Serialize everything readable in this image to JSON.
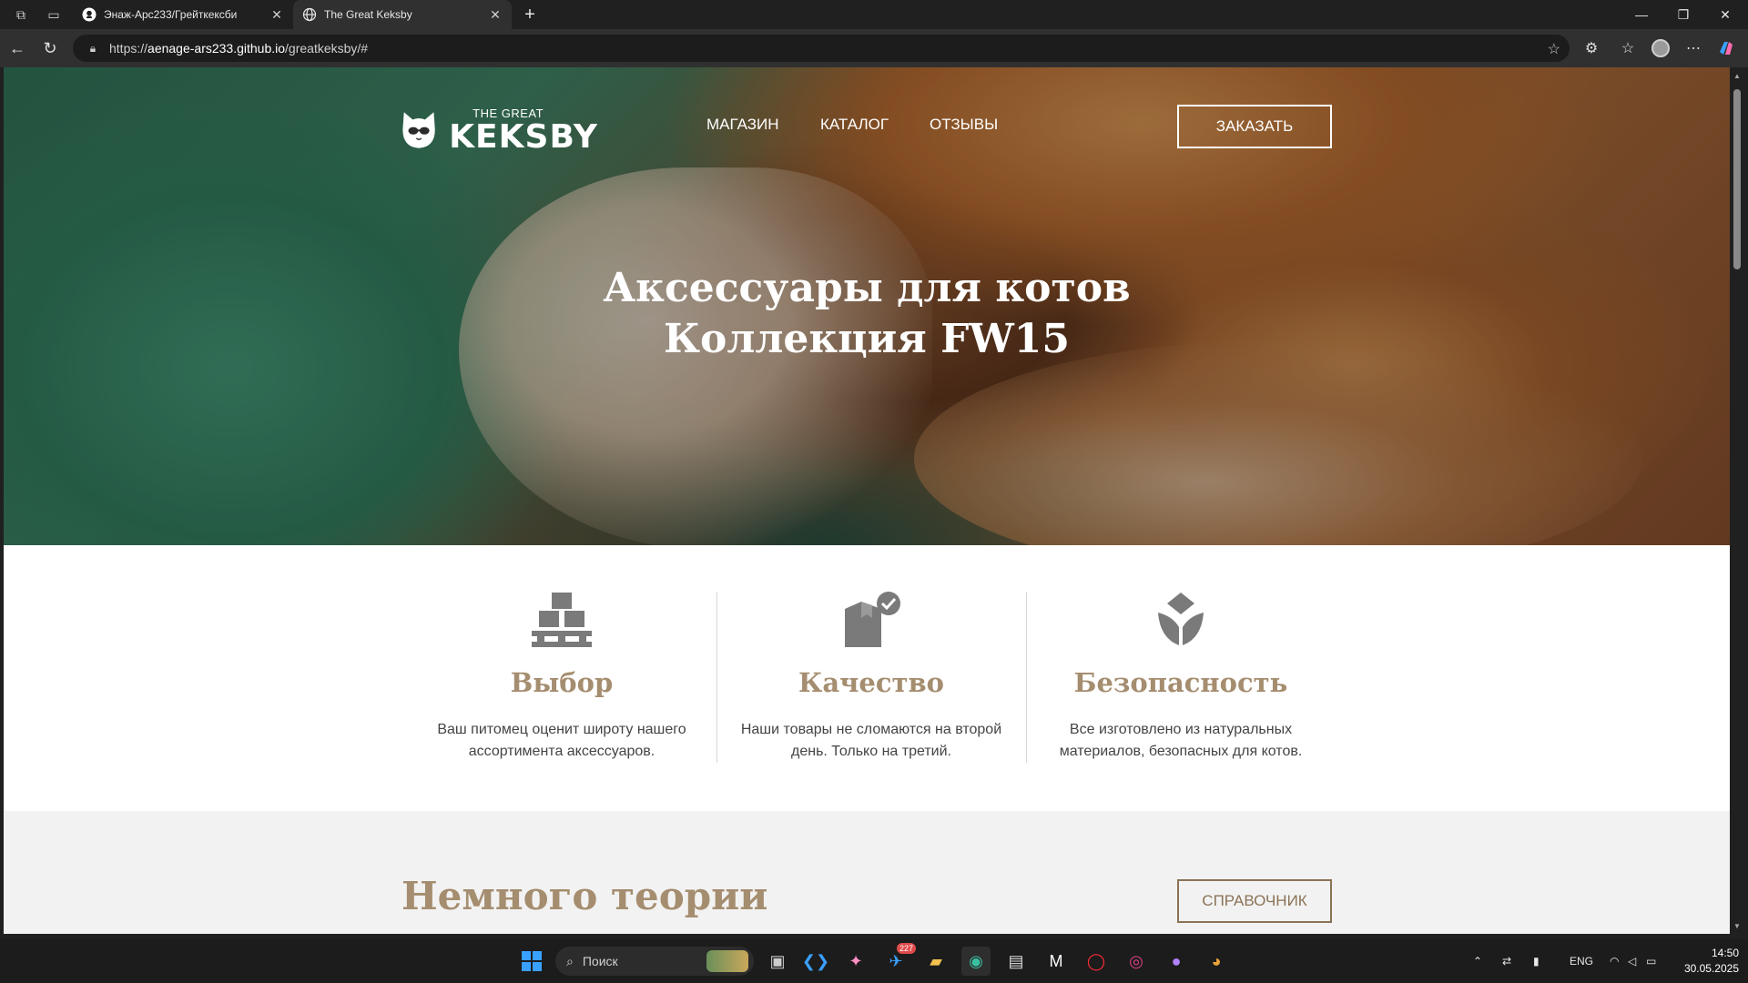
{
  "browser": {
    "tabs": [
      {
        "title": "Энаж-Арс233/Грейткексби",
        "icon": "github-icon"
      },
      {
        "title": "The Great Keksby",
        "icon": "globe-icon"
      }
    ],
    "url_prefix": "https://",
    "url_host": "aenage-ars233.github.io",
    "url_path": "/greatkeksby/#"
  },
  "site": {
    "logo": {
      "small": "THE GREAT",
      "big": "KEKSBY"
    },
    "menu": [
      "МАГАЗИН",
      "КАТАЛОГ",
      "ОТЗЫВЫ"
    ],
    "order_button": "ЗАКАЗАТЬ",
    "hero": {
      "line1": "Аксессуары для котов",
      "line2": "Коллекция FW15"
    },
    "features": [
      {
        "icon": "boxes-pallet-icon",
        "title": "Выбор",
        "text": "Ваш питомец оценит широту нашего ассортимента аксессуаров."
      },
      {
        "icon": "box-check-icon",
        "title": "Качество",
        "text": "Наши товары не сломаются на второй день. Только на третий."
      },
      {
        "icon": "leaf-shield-icon",
        "title": "Безопасность",
        "text": "Все изготовлено из натуральных материалов, безопасных для котов."
      }
    ],
    "theory": {
      "title": "Немного теории",
      "button": "СПРАВОЧНИК"
    },
    "colors": {
      "accent": "#a58d6f",
      "button_border": "#8a7356"
    }
  },
  "taskbar": {
    "search_placeholder": "Поиск",
    "telegram_badge": "227",
    "lang": "ENG",
    "time": "14:50",
    "date": "30.05.2025"
  }
}
